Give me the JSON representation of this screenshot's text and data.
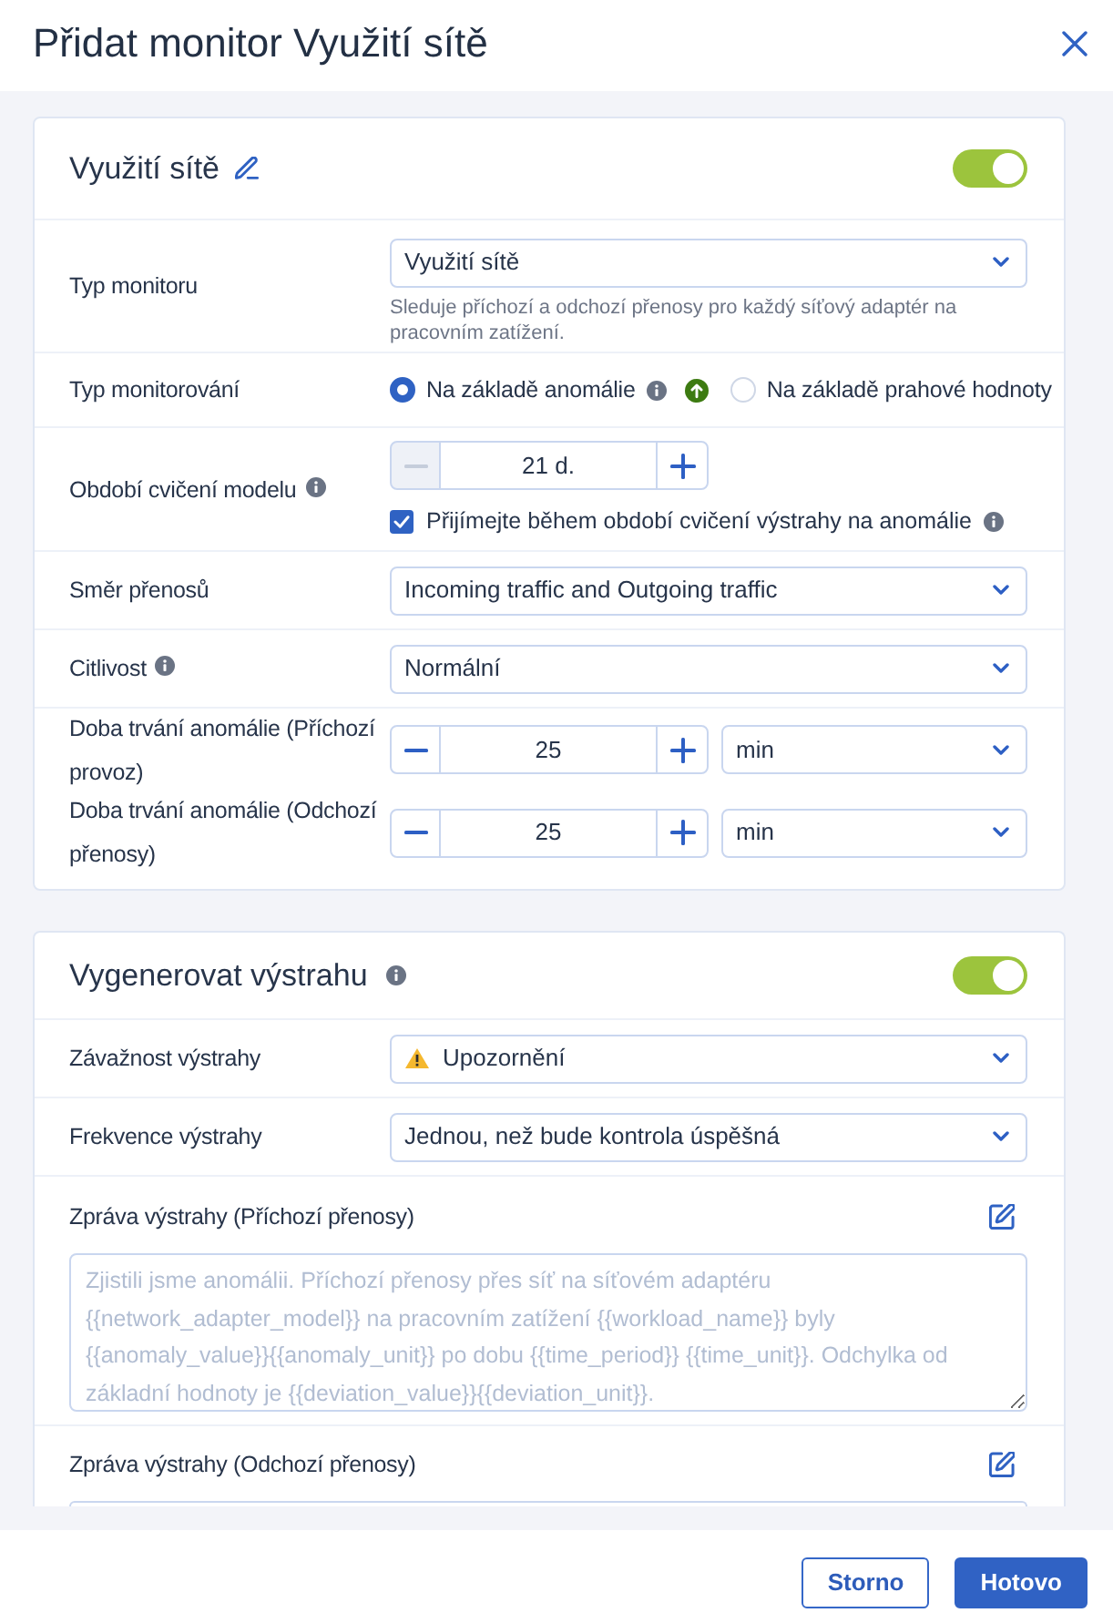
{
  "dialog": {
    "title": "Přidat monitor Využití sítě"
  },
  "sections": [
    {
      "title": "Využití sítě",
      "editable": true,
      "on": true,
      "rows": [
        {
          "kind": "select",
          "label": "Typ monitoru",
          "value": "Využití sítě",
          "hint": "Sleduje příchozí a odchozí přenosy pro každý síťový adaptér na pracovním zatížení."
        },
        {
          "kind": "radio",
          "label": "Typ monitorování",
          "options": [
            {
              "label": "Na základě anomálie",
              "selected": true,
              "info": true,
              "arrow_badge": true
            },
            {
              "label": "Na základě prahové hodnoty",
              "selected": false
            }
          ]
        },
        {
          "kind": "stepper",
          "label": "Období cvičení modelu",
          "info": true,
          "value": "21 d.",
          "decrement_disabled": true,
          "checkbox": {
            "label": "Přijímejte během období cvičení výstrahy na anomálie",
            "checked": true,
            "info": true
          }
        },
        {
          "kind": "select",
          "label": "Směr přenosů",
          "value": "Incoming traffic and Outgoing traffic"
        },
        {
          "kind": "select",
          "label": "Citlivost",
          "info": true,
          "value": "Normální"
        },
        {
          "kind": "duration",
          "label": "Doba trvání anomálie (Příchozí provoz)",
          "value": "25",
          "unit": "min",
          "decrement_disabled": false
        },
        {
          "kind": "duration",
          "label": "Doba trvání anomálie (Odchozí přenosy)",
          "value": "25",
          "unit": "min",
          "decrement_disabled": false
        }
      ]
    },
    {
      "title": "Vygenerovat výstrahu",
      "info": true,
      "on": true,
      "rows": [
        {
          "kind": "severity",
          "label": "Závažnost výstrahy",
          "value": "Upozornění"
        },
        {
          "kind": "select",
          "label": "Frekvence výstrahy",
          "value": "Jednou, než bude kontrola úspěšná"
        },
        {
          "kind": "message",
          "label": "Zpráva výstrahy (Příchozí přenosy)",
          "placeholder": "Zjistili jsme anomálii. Příchozí přenosy přes síť na síťovém adaptéru {{network_adapter_model}} na pracovním zatížení {{workload_name}} byly {{anomaly_value}}{{anomaly_unit}} po dobu {{time_period}} {{time_unit}}. Odchylka od základní hodnoty je {{deviation_value}}{{deviation_unit}}."
        },
        {
          "kind": "message",
          "label": "Zpráva výstrahy (Odchozí přenosy)"
        }
      ]
    }
  ],
  "footer": {
    "buttons": [
      {
        "label": "Storno",
        "kind": "secondary"
      },
      {
        "label": "Hotovo",
        "kind": "primary"
      }
    ]
  }
}
